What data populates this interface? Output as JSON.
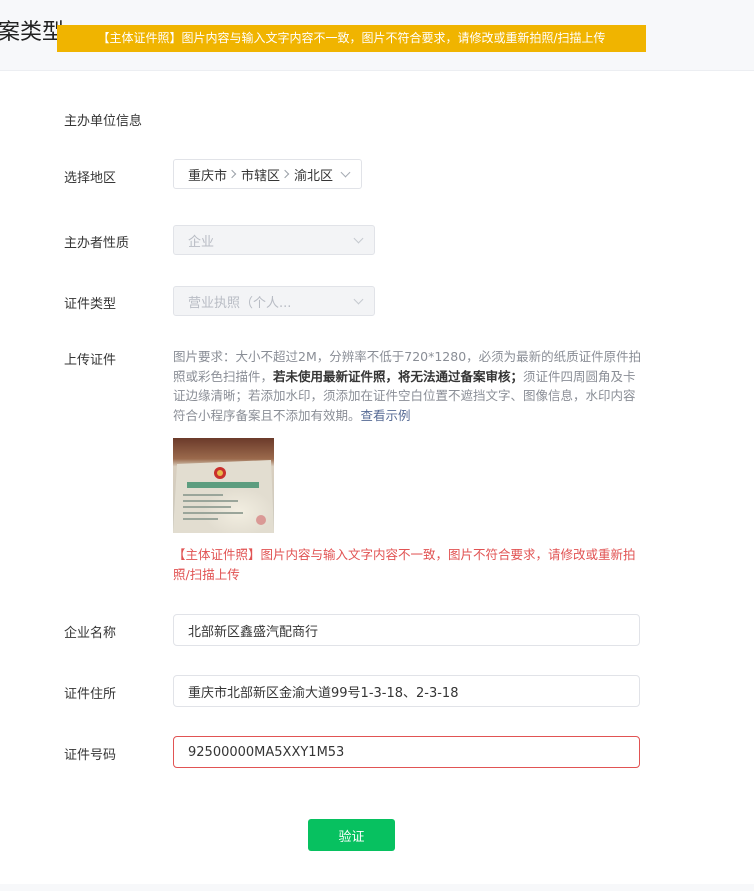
{
  "header": {
    "title": "案类型",
    "warning": "【主体证件照】图片内容与输入文字内容不一致，图片不符合要求，请修改或重新拍照/扫描上传"
  },
  "section": {
    "heading": "主办单位信息"
  },
  "form": {
    "region": {
      "label": "选择地区",
      "province": "重庆市",
      "city": "市辖区",
      "district": "渝北区"
    },
    "organizer_type": {
      "label": "主办者性质",
      "value": "企业"
    },
    "certificate_type": {
      "label": "证件类型",
      "value": "营业执照（个人..."
    },
    "upload": {
      "label": "上传证件",
      "hint_part1": "图片要求：大小不超过2M，分辨率不低于720*1280，必须为最新的纸质证件原件拍照或彩色扫描件，",
      "hint_bold1": "若未使用最新证件照，将无法通过备案审核；",
      "hint_part2": "须证件四周圆角及卡证边缘清晰；若添加水印，须添加在证件空白位置不遮挡文字、图像信息，水印内容符合小程序备案且不添加有效期。",
      "hint_link": "查看示例",
      "error": "【主体证件照】图片内容与输入文字内容不一致，图片不符合要求，请修改或重新拍照/扫描上传"
    },
    "company_name": {
      "label": "企业名称",
      "value": "北部新区鑫盛汽配商行"
    },
    "address": {
      "label": "证件住所",
      "value": "重庆市北部新区金渝大道99号1-3-18、2-3-18"
    },
    "certificate_number": {
      "label": "证件号码",
      "value": "92500000MA5XXY1M53"
    }
  },
  "actions": {
    "verify_label": "验证"
  },
  "colors": {
    "warning_bg": "#f0b400",
    "error": "#e15353",
    "primary_button": "#07c160"
  }
}
